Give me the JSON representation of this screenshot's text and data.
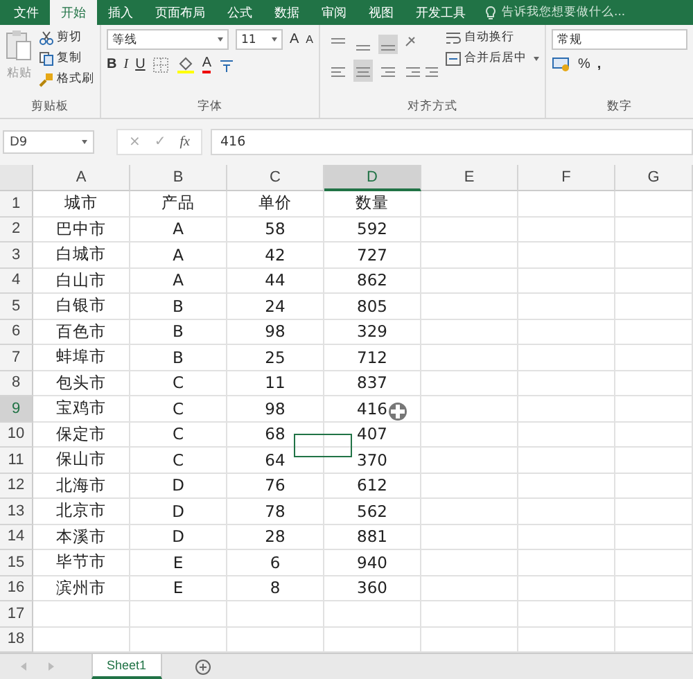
{
  "ribbon_tabs": [
    {
      "label": "文件",
      "selected": false
    },
    {
      "label": "开始",
      "selected": true
    },
    {
      "label": "插入",
      "selected": false
    },
    {
      "label": "页面布局",
      "selected": false
    },
    {
      "label": "公式",
      "selected": false
    },
    {
      "label": "数据",
      "selected": false
    },
    {
      "label": "审阅",
      "selected": false
    },
    {
      "label": "视图",
      "selected": false
    },
    {
      "label": "开发工具",
      "selected": false
    }
  ],
  "tell_me": "告诉我您想要做什么...",
  "clipboard": {
    "paste": "粘贴",
    "cut": "剪切",
    "copy": "复制",
    "format_painter": "格式刷",
    "label": "剪贴板"
  },
  "font": {
    "name": "等线",
    "size": "11",
    "grow": "A",
    "shrink": "A",
    "bold": "B",
    "italic": "I",
    "underline": "U",
    "font_color": "A",
    "label": "字体"
  },
  "alignment": {
    "wrap": "自动换行",
    "merge": "合并后居中",
    "label": "对齐方式"
  },
  "number": {
    "format": "常规",
    "percent": "%",
    "comma": ",",
    "label": "数字"
  },
  "formula_bar": {
    "name_box": "D9",
    "cancel": "×",
    "enter": "✓",
    "function": "fx",
    "value": "416"
  },
  "columns": [
    {
      "label": "A",
      "selected": false
    },
    {
      "label": "B",
      "selected": false
    },
    {
      "label": "C",
      "selected": false
    },
    {
      "label": "D",
      "selected": true
    },
    {
      "label": "E",
      "selected": false
    },
    {
      "label": "F",
      "selected": false
    },
    {
      "label": "G",
      "selected": false
    }
  ],
  "rows": [
    {
      "number": "1",
      "selected": false,
      "cells": [
        "城市",
        "产品",
        "单价",
        "数量"
      ]
    },
    {
      "number": "2",
      "selected": false,
      "cells": [
        "巴中市",
        "A",
        "58",
        "592"
      ]
    },
    {
      "number": "3",
      "selected": false,
      "cells": [
        "白城市",
        "A",
        "42",
        "727"
      ]
    },
    {
      "number": "4",
      "selected": false,
      "cells": [
        "白山市",
        "A",
        "44",
        "862"
      ]
    },
    {
      "number": "5",
      "selected": false,
      "cells": [
        "白银市",
        "B",
        "24",
        "805"
      ]
    },
    {
      "number": "6",
      "selected": false,
      "cells": [
        "百色市",
        "B",
        "98",
        "329"
      ]
    },
    {
      "number": "7",
      "selected": false,
      "cells": [
        "蚌埠市",
        "B",
        "25",
        "712"
      ]
    },
    {
      "number": "8",
      "selected": false,
      "cells": [
        "包头市",
        "C",
        "11",
        "837"
      ]
    },
    {
      "number": "9",
      "selected": true,
      "cells": [
        "宝鸡市",
        "C",
        "98",
        "416"
      ]
    },
    {
      "number": "10",
      "selected": false,
      "cells": [
        "保定市",
        "C",
        "68",
        "407"
      ]
    },
    {
      "number": "11",
      "selected": false,
      "cells": [
        "保山市",
        "C",
        "64",
        "370"
      ]
    },
    {
      "number": "12",
      "selected": false,
      "cells": [
        "北海市",
        "D",
        "76",
        "612"
      ]
    },
    {
      "number": "13",
      "selected": false,
      "cells": [
        "北京市",
        "D",
        "78",
        "562"
      ]
    },
    {
      "number": "14",
      "selected": false,
      "cells": [
        "本溪市",
        "D",
        "28",
        "881"
      ]
    },
    {
      "number": "15",
      "selected": false,
      "cells": [
        "毕节市",
        "E",
        "6",
        "940"
      ]
    },
    {
      "number": "16",
      "selected": false,
      "cells": [
        "滨州市",
        "E",
        "8",
        "360"
      ]
    },
    {
      "number": "17",
      "selected": false,
      "cells": []
    },
    {
      "number": "18",
      "selected": false,
      "cells": []
    }
  ],
  "sheets": [
    {
      "label": "Sheet1",
      "selected": true
    }
  ]
}
